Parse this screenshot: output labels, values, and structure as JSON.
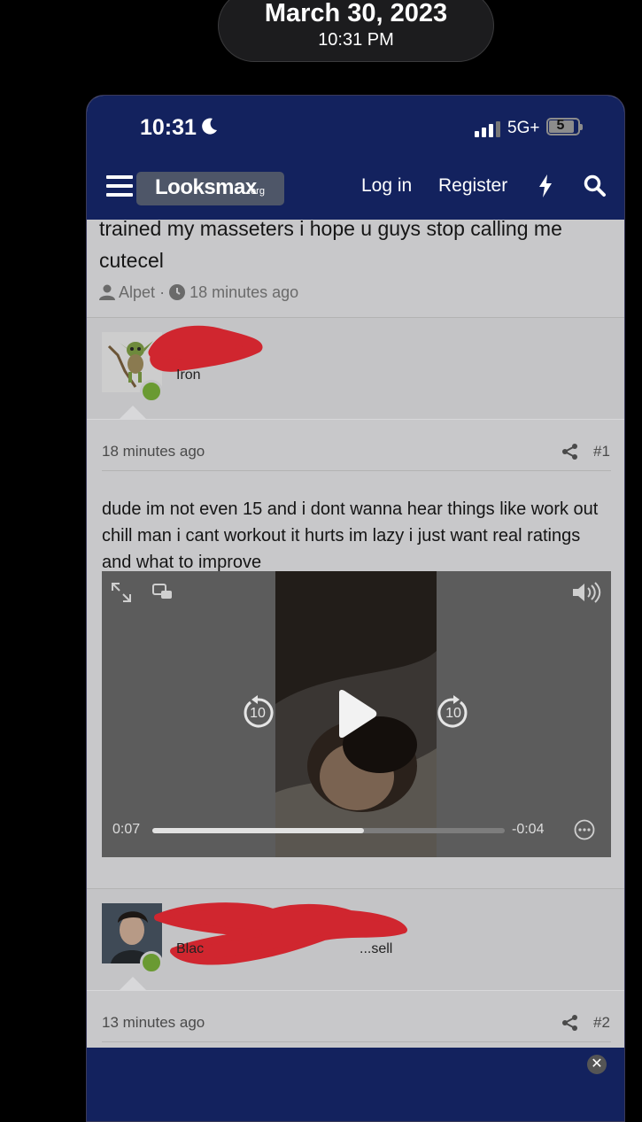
{
  "overlay": {
    "date": "March 30, 2023",
    "time": "10:31 PM"
  },
  "status_bar": {
    "time": "10:31",
    "network": "5G+",
    "battery": "5"
  },
  "nav": {
    "logo": "Looksmax",
    "logo_suffix": ".org",
    "login": "Log in",
    "register": "Register"
  },
  "thread": {
    "title": "trained my masseters i hope u guys stop calling me cutecel",
    "author": "Alpet",
    "separator": "·",
    "time_ago": "18 minutes ago"
  },
  "posts": [
    {
      "username": "Iron",
      "date": "18 minutes ago",
      "number": "#1",
      "text": "dude im not even 15 and i dont wanna hear things like work out chill man i cant workout it hurts im lazy i just want real ratings and what to improve",
      "video": {
        "elapsed": "0:07",
        "remaining": "-0:04",
        "skip_seconds": "10",
        "progress": 0.6
      }
    },
    {
      "username": "Blac",
      "username_tail": "...sell",
      "date": "13 minutes ago",
      "number": "#2"
    }
  ],
  "colors": {
    "navbar": "#13225e",
    "online": "#6a9a32",
    "redaction": "#d0262f"
  }
}
